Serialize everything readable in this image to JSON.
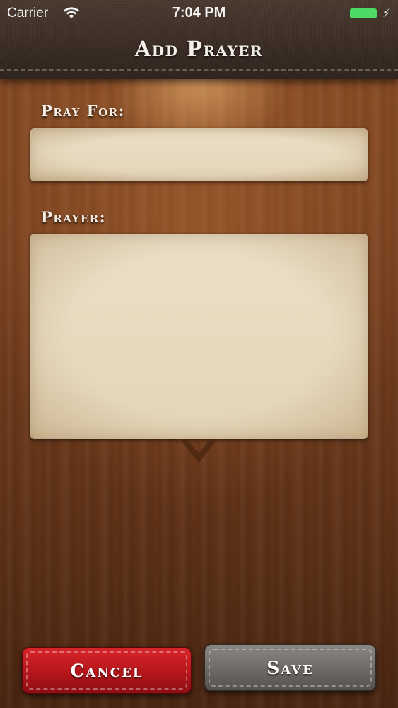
{
  "status_bar": {
    "carrier": "Carrier",
    "time": "7:04 PM",
    "battery_level": 1.0,
    "battery_color": "#4cd964"
  },
  "header": {
    "title": "Add Prayer"
  },
  "form": {
    "pray_for_label": "Pray For:",
    "pray_for_value": "",
    "prayer_label": "Prayer:",
    "prayer_value": ""
  },
  "actions": {
    "cancel_label": "Cancel",
    "save_label": "Save",
    "cancel_color": "#c41d21",
    "save_color": "#6d6964"
  },
  "icons": {
    "wifi": "wifi-icon",
    "battery": "battery-icon",
    "charging": "charging-bolt-icon",
    "notch": "chevron-down-icon"
  }
}
